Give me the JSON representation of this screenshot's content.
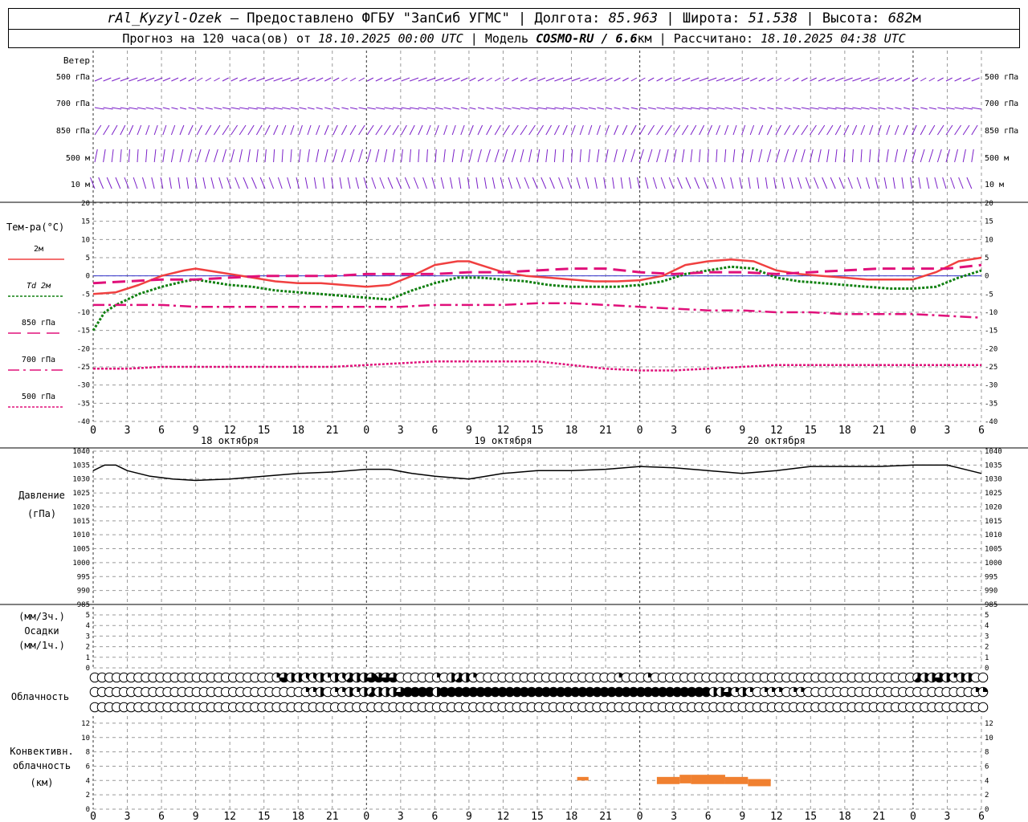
{
  "header": {
    "station": "rAl_Kyzyl-Ozek",
    "provided_by": "— Предоставлено ФГБУ \"ЗапСиб УГМС\"",
    "lon_label": "Долгота:",
    "lon": "85.963",
    "lat_label": "Широта:",
    "lat": "51.538",
    "alt_label": "Высота:",
    "alt": "682",
    "alt_unit": "м",
    "forecast_label": "Прогноз на 120 часа(ов) от",
    "forecast_start": "18.10.2025 00:00 UTC",
    "model_label": "Модель",
    "model": "COSMO-RU / 6.6",
    "model_unit": "км",
    "computed_label": "Рассчитано:",
    "computed": "18.10.2025 04:38 UTC"
  },
  "colors": {
    "wind": "#7a1fc8",
    "t2m": "#f04040",
    "td2m": "#108010",
    "t850": "#e0107a",
    "t700": "#e0107a",
    "t500": "#e0107a",
    "pressure": "#000000",
    "conv": "#f08030",
    "grid": "#9a9a9a",
    "zero": "#3333cc"
  },
  "chart_data": {
    "x_hours": [
      0,
      3,
      6,
      9,
      12,
      15,
      18,
      21,
      24,
      27,
      30,
      33,
      36,
      39,
      42,
      45,
      48,
      51,
      54,
      57,
      60,
      63,
      66,
      69,
      72,
      75,
      78
    ],
    "x_tick_labels": [
      "0",
      "3",
      "6",
      "9",
      "12",
      "15",
      "18",
      "21",
      "0",
      "3",
      "6",
      "9",
      "12",
      "15",
      "18",
      "21",
      "0",
      "3",
      "6",
      "9",
      "12",
      "15",
      "18",
      "21",
      "0",
      "3",
      "6"
    ],
    "day_labels": [
      {
        "hour": 12,
        "text": "18 октября"
      },
      {
        "hour": 36,
        "text": "19 октября"
      },
      {
        "hour": 60,
        "text": "20 октября"
      }
    ],
    "wind": {
      "title": "Ветер",
      "levels": [
        "500 гПа",
        "700 гПа",
        "850 гПа",
        "500 м",
        "10  м"
      ]
    },
    "temperature": {
      "type": "line",
      "ylabel": "Тем-ра(°C)",
      "ylim": [
        -40,
        20
      ],
      "yticks": [
        20,
        15,
        10,
        5,
        0,
        -5,
        -10,
        -15,
        -20,
        -25,
        -30,
        -35,
        -40
      ],
      "series": [
        {
          "key": "t2m",
          "name": "2м",
          "style": "solid",
          "width": 2.5,
          "x": [
            0,
            2,
            4,
            6,
            8,
            9,
            10,
            12,
            14,
            16,
            18,
            20,
            22,
            24,
            26,
            28,
            30,
            32,
            33,
            34,
            36,
            38,
            40,
            42,
            44,
            46,
            48,
            50,
            52,
            54,
            56,
            58,
            60,
            62,
            64,
            66,
            68,
            70,
            72,
            74,
            76,
            78
          ],
          "y": [
            -5,
            -4.5,
            -2.5,
            0,
            1.5,
            2,
            1.5,
            0.5,
            -0.5,
            -1.5,
            -2,
            -2,
            -2.5,
            -3,
            -2.5,
            0,
            3,
            4,
            4,
            3,
            1,
            0,
            -0.5,
            -1,
            -1.5,
            -1.5,
            -1.2,
            0,
            3,
            4,
            4.5,
            4,
            1.5,
            0.5,
            0,
            -0.5,
            -1,
            -1,
            -1,
            1,
            4,
            5
          ]
        },
        {
          "key": "td2m",
          "name": "2м",
          "legend_prefix": "Td",
          "style": "dotted",
          "width": 3,
          "x": [
            0,
            1,
            2,
            4,
            6,
            8,
            9,
            10,
            12,
            14,
            16,
            18,
            20,
            22,
            24,
            26,
            28,
            30,
            32,
            34,
            36,
            38,
            40,
            42,
            44,
            46,
            48,
            50,
            52,
            54,
            56,
            58,
            60,
            62,
            64,
            66,
            68,
            70,
            72,
            74,
            76,
            78
          ],
          "y": [
            -15,
            -10,
            -8,
            -5,
            -3,
            -1.5,
            -1,
            -1.5,
            -2.5,
            -3,
            -4,
            -4.5,
            -5,
            -5.5,
            -6,
            -6.5,
            -4,
            -2,
            -0.5,
            -0.5,
            -1,
            -1.5,
            -2.5,
            -3,
            -3,
            -3,
            -2.5,
            -1.5,
            0.5,
            1.5,
            2.5,
            2,
            -0.5,
            -1.5,
            -2,
            -2.5,
            -3,
            -3.5,
            -3.5,
            -3,
            -0.5,
            1.5
          ]
        },
        {
          "key": "t850",
          "name": "850 гПа",
          "style": "longdash",
          "width": 3,
          "x": [
            0,
            3,
            6,
            9,
            12,
            15,
            18,
            21,
            24,
            27,
            30,
            33,
            36,
            39,
            42,
            45,
            48,
            51,
            54,
            57,
            60,
            63,
            66,
            69,
            72,
            75,
            78
          ],
          "y": [
            -2,
            -1.5,
            -1,
            -1,
            -0.5,
            0,
            0,
            0,
            0.5,
            0.5,
            0.5,
            1,
            1,
            1.5,
            2,
            2,
            1,
            0.5,
            1,
            1,
            0.5,
            1,
            1.5,
            2,
            2,
            2,
            3
          ]
        },
        {
          "key": "t700",
          "name": "700 гПа",
          "style": "dashdot",
          "width": 2.5,
          "x": [
            0,
            3,
            6,
            9,
            12,
            15,
            18,
            21,
            24,
            27,
            30,
            33,
            36,
            39,
            42,
            45,
            48,
            51,
            54,
            57,
            60,
            63,
            66,
            69,
            72,
            75,
            78
          ],
          "y": [
            -8,
            -8,
            -8,
            -8.5,
            -8.5,
            -8.5,
            -8.5,
            -8.5,
            -8.5,
            -8.5,
            -8,
            -8,
            -8,
            -7.5,
            -7.5,
            -8,
            -8.5,
            -9,
            -9.5,
            -9.5,
            -10,
            -10,
            -10.5,
            -10.5,
            -10.5,
            -11,
            -11.5
          ]
        },
        {
          "key": "t500",
          "name": "500 гПа",
          "style": "dotted",
          "width": 2.5,
          "x": [
            0,
            3,
            6,
            9,
            12,
            15,
            18,
            21,
            24,
            27,
            30,
            33,
            36,
            39,
            42,
            45,
            48,
            51,
            54,
            57,
            60,
            63,
            66,
            69,
            72,
            75,
            78
          ],
          "y": [
            -25.5,
            -25.5,
            -25,
            -25,
            -25,
            -25,
            -25,
            -25,
            -24.5,
            -24,
            -23.5,
            -23.5,
            -23.5,
            -23.5,
            -24.5,
            -25.5,
            -26,
            -26,
            -25.5,
            -25,
            -24.5,
            -24.5,
            -24.5,
            -24.5,
            -24.5,
            -24.5,
            -24.5
          ]
        }
      ]
    },
    "pressure": {
      "type": "line",
      "ylabel": [
        "Давление",
        "(гПа)"
      ],
      "ylim": [
        985,
        1040
      ],
      "yticks": [
        1040,
        1035,
        1030,
        1025,
        1020,
        1015,
        1010,
        1005,
        1000,
        995,
        990,
        985
      ],
      "x": [
        0,
        1,
        2,
        3,
        5,
        7,
        9,
        12,
        15,
        18,
        21,
        24,
        26,
        28,
        30,
        33,
        36,
        39,
        42,
        45,
        48,
        51,
        54,
        57,
        60,
        63,
        66,
        69,
        72,
        75,
        76,
        78
      ],
      "y": [
        1033,
        1035,
        1035,
        1033,
        1031,
        1030,
        1029.5,
        1030,
        1031,
        1032,
        1032.5,
        1033.5,
        1033.5,
        1032,
        1031,
        1030,
        1032,
        1033,
        1033,
        1033.5,
        1034.5,
        1034,
        1033,
        1032,
        1033,
        1034.5,
        1034.5,
        1034.5,
        1035,
        1035,
        1034,
        1032
      ]
    },
    "precip": {
      "type": "bar",
      "ylabel": [
        "(мм/3ч.)",
        "Осадки",
        "(мм/1ч.)"
      ],
      "ylim": [
        0,
        5
      ],
      "yticks": [
        5,
        4,
        3,
        2,
        1,
        0
      ],
      "values": []
    },
    "cloud": {
      "ylabel": "Облачность",
      "row1": [
        0,
        0,
        0,
        0,
        0,
        0,
        0,
        0,
        0,
        0,
        0,
        0,
        0,
        0,
        0,
        0,
        0,
        0,
        0,
        0,
        0,
        0,
        0,
        0,
        0,
        2,
        6,
        4,
        4,
        3,
        3,
        4,
        2,
        4,
        3,
        5,
        4,
        4,
        6,
        7,
        6,
        6,
        0,
        0,
        0,
        0,
        0,
        2,
        0,
        4,
        5,
        4,
        2,
        0,
        0,
        0,
        0,
        0,
        0,
        0,
        0,
        0,
        0,
        0,
        0,
        0,
        0,
        0,
        0,
        0,
        0,
        0,
        2,
        0,
        0,
        0,
        2,
        0,
        0,
        0,
        0,
        0,
        0,
        0,
        0,
        0,
        0,
        0,
        0,
        0,
        0,
        0,
        0,
        0,
        0,
        0,
        0,
        0,
        0,
        0,
        0,
        0,
        0,
        0,
        0,
        0,
        0,
        0,
        0,
        0,
        0,
        0,
        0,
        5,
        4,
        4,
        6,
        4,
        2,
        4,
        4
      ],
      "row2": [
        0,
        0,
        0,
        0,
        0,
        0,
        0,
        0,
        0,
        0,
        0,
        0,
        0,
        0,
        0,
        0,
        0,
        0,
        0,
        0,
        0,
        0,
        0,
        0,
        0,
        0,
        0,
        0,
        0,
        2,
        2,
        4,
        0,
        2,
        2,
        4,
        2,
        4,
        5,
        4,
        4,
        4,
        6,
        8,
        8,
        8,
        8,
        4,
        8,
        8,
        8,
        8,
        8,
        8,
        8,
        8,
        8,
        8,
        8,
        8,
        8,
        8,
        8,
        8,
        8,
        8,
        8,
        8,
        8,
        8,
        8,
        8,
        8,
        8,
        8,
        8,
        8,
        8,
        8,
        8,
        8,
        8,
        8,
        8,
        8,
        4,
        4,
        6,
        2,
        4,
        2,
        0,
        2,
        2,
        2,
        0,
        2,
        2,
        0,
        0,
        0,
        0,
        0,
        0,
        0,
        0,
        0,
        0,
        0,
        0,
        0,
        0,
        0,
        0,
        0,
        0,
        0,
        0,
        0,
        0,
        0,
        2,
        2,
        4,
        4,
        8,
        8,
        8
      ],
      "row3": []
    },
    "convective": {
      "type": "bar",
      "ylabel": [
        "Конвективн.",
        "облачность",
        "(км)"
      ],
      "ylim": [
        0,
        13
      ],
      "yticks": [
        12,
        10,
        8,
        6,
        4,
        2,
        0
      ],
      "segments": [
        {
          "x0": 42.5,
          "x1": 43.5,
          "base": 4.0,
          "top": 4.5
        },
        {
          "x0": 49.5,
          "x1": 51.5,
          "base": 3.5,
          "top": 4.5
        },
        {
          "x0": 51.5,
          "x1": 52.5,
          "base": 3.6,
          "top": 4.8
        },
        {
          "x0": 52.5,
          "x1": 55.5,
          "base": 3.5,
          "top": 4.8
        },
        {
          "x0": 55.5,
          "x1": 57.5,
          "base": 3.5,
          "top": 4.5
        },
        {
          "x0": 57.5,
          "x1": 59.5,
          "base": 3.2,
          "top": 4.2
        }
      ]
    }
  }
}
